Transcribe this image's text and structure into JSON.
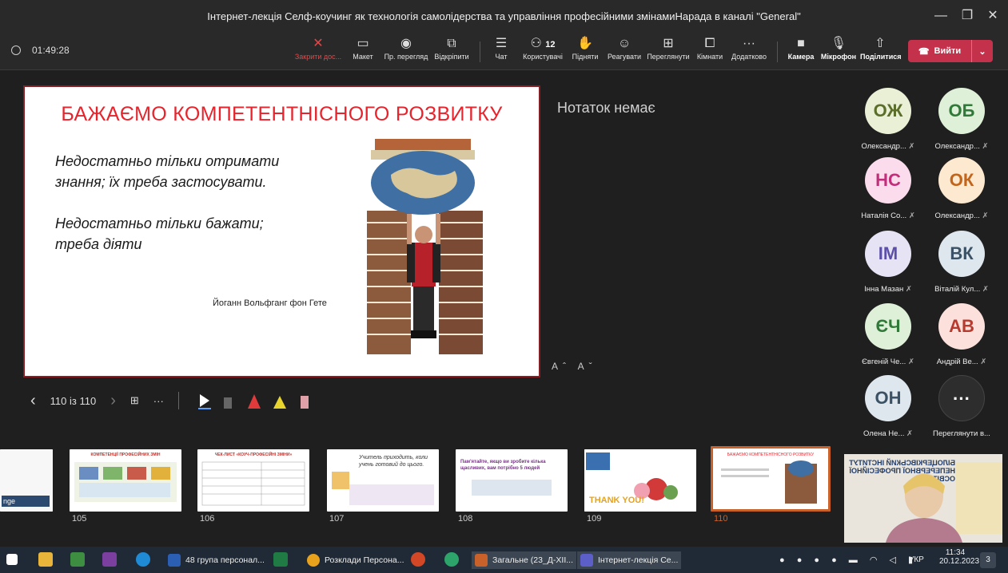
{
  "window": {
    "title": "Інтернет-лекція Селф-коучинг як технологія самолідерства та управління професійними змінамиНарада в каналі \"General\"",
    "controls": [
      "—",
      "❐",
      "✕"
    ]
  },
  "toolbar": {
    "timer": "01:49:28",
    "buttons": [
      {
        "label": "Закрити дос...",
        "icon": "✕"
      },
      {
        "label": "Макет",
        "icon": "▭"
      },
      {
        "label": "Пр. перегляд",
        "icon": "◉"
      },
      {
        "label": "Відкріпити",
        "icon": "⧉"
      },
      {
        "label": "Чат",
        "icon": "☰"
      },
      {
        "label": "Користувачі",
        "icon": "⚇",
        "count": "12"
      },
      {
        "label": "Підняти",
        "icon": "✋"
      },
      {
        "label": "Реагувати",
        "icon": "☺"
      },
      {
        "label": "Переглянути",
        "icon": "⊞"
      },
      {
        "label": "Кімнати",
        "icon": "⧠"
      },
      {
        "label": "Додатково",
        "icon": "···"
      },
      {
        "label": "Камера",
        "icon": "■"
      },
      {
        "label": "Мікрофон",
        "icon": "🎙"
      },
      {
        "label": "Поділитися",
        "icon": "⇧"
      }
    ],
    "leave_label": "Вийти",
    "leave_icon": "☎",
    "leave_dropdown": "⌄"
  },
  "slide": {
    "title": "БАЖАЄМО КОМПЕТЕНТНІСНОГО РОЗВИТКУ",
    "line1": "Недостатньо тільки отримати",
    "line2": "знання; їх треба застосувати.",
    "line3": "Недостатньо тільки бажати;",
    "line4": "треба діяти",
    "author": "Йоганн Вольфганг фон Гете"
  },
  "notes": {
    "text": "Нотаток немає",
    "font_controls": "Aˆ Aˇ"
  },
  "slide_controls": {
    "prev": "‹",
    "counter": "110 із 110",
    "next": "›",
    "grid_icon": "⊞",
    "more": "···"
  },
  "participants": [
    {
      "initials": "ОЖ",
      "name": "Олександр...",
      "bg": "#e9f0d6",
      "fg": "#5b6e2a"
    },
    {
      "initials": "ОБ",
      "name": "Олександр...",
      "bg": "#dff0d9",
      "fg": "#2f7a38"
    },
    {
      "initials": "НС",
      "name": "Наталія Со...",
      "bg": "#fbdcec",
      "fg": "#c0307a"
    },
    {
      "initials": "ОК",
      "name": "Олександр...",
      "bg": "#fde8d0",
      "fg": "#c2651c"
    },
    {
      "initials": "ІМ",
      "name": "Інна Мазан",
      "bg": "#e6e3f5",
      "fg": "#5b4fa8"
    },
    {
      "initials": "ВК",
      "name": "Віталій Кул...",
      "bg": "#dfe7ee",
      "fg": "#3b5266"
    },
    {
      "initials": "ЄЧ",
      "name": "Євгеній Че...",
      "bg": "#dff0d9",
      "fg": "#2f7a38"
    },
    {
      "initials": "АВ",
      "name": "Андрій Ве...",
      "bg": "#fbe0dc",
      "fg": "#b83a2e"
    },
    {
      "initials": "ОН",
      "name": "Олена Не...",
      "bg": "#dfe7ee",
      "fg": "#3b5266"
    },
    {
      "initials": "···",
      "name": "Переглянути в...",
      "bg": "#2d2d2d",
      "fg": "#ffffff"
    }
  ],
  "thumbnails": {
    "numbers": [
      "105",
      "106",
      "107",
      "108",
      "109",
      "110"
    ],
    "t105_title": "КОМПЕТЕНЦІЇ ПРОФЕСІЙНИХ ЗМІН",
    "t106_title": "ЧЕК-ЛИСТ «КОУЧ-ПРОФЕСІЙНІ ЗМІНИ»",
    "t107_text": "Учитель приходить, коли учень готовий до цього.",
    "t108_text": "Пам'ятайте, якщо ви зробите кілька щасливих, вам потрібно 5 людей",
    "t109_text": "THANK YOU!",
    "t110_title": "БАЖАЄМО КОМПЕТЕНТНІСНОГО РОЗВИТКУ"
  },
  "video": {
    "banner": "БІЛОЦЕРКІВСЬКИЙ ІНСТИТУТ НЕПЕРЕРВНОЇ ПРОФЕСІЙНОЇ ОСВІТИ"
  },
  "taskbar": {
    "items": [
      "48 група персонал...",
      "Розклади Персона...",
      "Загальне (23_Д-ХІІ...",
      "Інтернет-лекція Се..."
    ],
    "lang": "УКР",
    "time": "11:34",
    "date": "20.12.2023",
    "notif_count": "3"
  }
}
